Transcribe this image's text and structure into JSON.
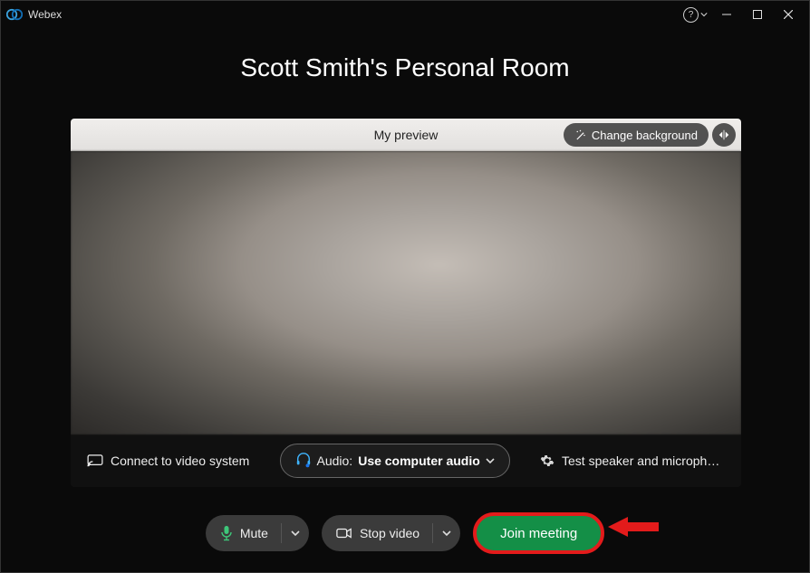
{
  "window": {
    "title": "Webex"
  },
  "room_title": "Scott Smith's Personal Room",
  "preview": {
    "header_label": "My preview",
    "change_background": "Change background"
  },
  "footer": {
    "connect_video_system": "Connect to video system",
    "audio_prefix": "Audio: ",
    "audio_value": "Use computer audio",
    "test_speaker": "Test speaker and microphone"
  },
  "controls": {
    "mute": "Mute",
    "stop_video": "Stop video",
    "join": "Join meeting"
  }
}
